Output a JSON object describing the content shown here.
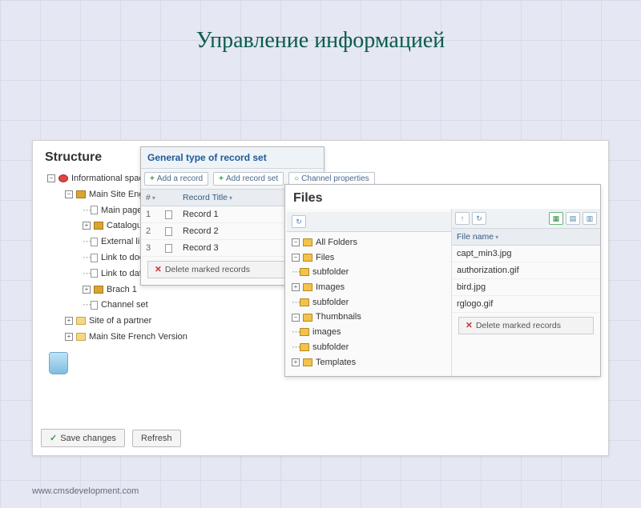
{
  "slide": {
    "title": "Управление информацией"
  },
  "footer": {
    "url": "www.cmsdevelopment.com"
  },
  "structure": {
    "title": "Structure",
    "tree": [
      {
        "indent": 0,
        "exp": "-",
        "icon": "world",
        "label": "Informational space"
      },
      {
        "indent": 1,
        "exp": "-",
        "icon": "yellow",
        "label": "Main Site English Ve"
      },
      {
        "indent": 2,
        "exp": "",
        "icon": "page",
        "label": "Main page"
      },
      {
        "indent": 2,
        "exp": "+",
        "icon": "yellow",
        "label": "Catalogue"
      },
      {
        "indent": 2,
        "exp": "",
        "icon": "page",
        "label": "External link"
      },
      {
        "indent": 2,
        "exp": "",
        "icon": "page",
        "label": "Link to documen"
      },
      {
        "indent": 2,
        "exp": "",
        "icon": "page",
        "label": "Link to data"
      },
      {
        "indent": 2,
        "exp": "+",
        "icon": "yellow",
        "label": "Brach 1"
      },
      {
        "indent": 2,
        "exp": "",
        "icon": "page",
        "label": "Channel set"
      },
      {
        "indent": 1,
        "exp": "+",
        "icon": "lyellow",
        "label": "Site of a partner"
      },
      {
        "indent": 1,
        "exp": "+",
        "icon": "lyellow",
        "label": "Main Site French Version"
      }
    ],
    "buttons": {
      "save": "Save changes",
      "refresh": "Refresh"
    }
  },
  "records": {
    "title": "General type of record set",
    "actions": {
      "add_record": "Add a record",
      "add_set": "Add record set",
      "channel_props": "Channel properties"
    },
    "columns": {
      "num": "#",
      "title": "Record Title"
    },
    "rows": [
      {
        "n": "1",
        "t": "Record 1"
      },
      {
        "n": "2",
        "t": "Record 2"
      },
      {
        "n": "3",
        "t": "Record 3"
      }
    ],
    "delete": "Delete marked records"
  },
  "files": {
    "title": "Files",
    "tree": [
      {
        "indent": 0,
        "exp": "-",
        "label": "All Folders"
      },
      {
        "indent": 1,
        "exp": "-",
        "label": "Files"
      },
      {
        "indent": 2,
        "exp": "",
        "label": "subfolder"
      },
      {
        "indent": 1,
        "exp": "+",
        "label": "Images"
      },
      {
        "indent": 2,
        "exp": "",
        "label": "subfolder"
      },
      {
        "indent": 1,
        "exp": "-",
        "label": "Thumbnails"
      },
      {
        "indent": 2,
        "exp": "",
        "label": "images"
      },
      {
        "indent": 2,
        "exp": "",
        "label": "subfolder"
      },
      {
        "indent": 1,
        "exp": "+",
        "label": "Templates"
      }
    ],
    "list": {
      "column": "File name",
      "rows": [
        "capt_min3.jpg",
        "authorization.gif",
        "bird.jpg",
        "rglogo.gif"
      ],
      "delete": "Delete marked records"
    }
  }
}
